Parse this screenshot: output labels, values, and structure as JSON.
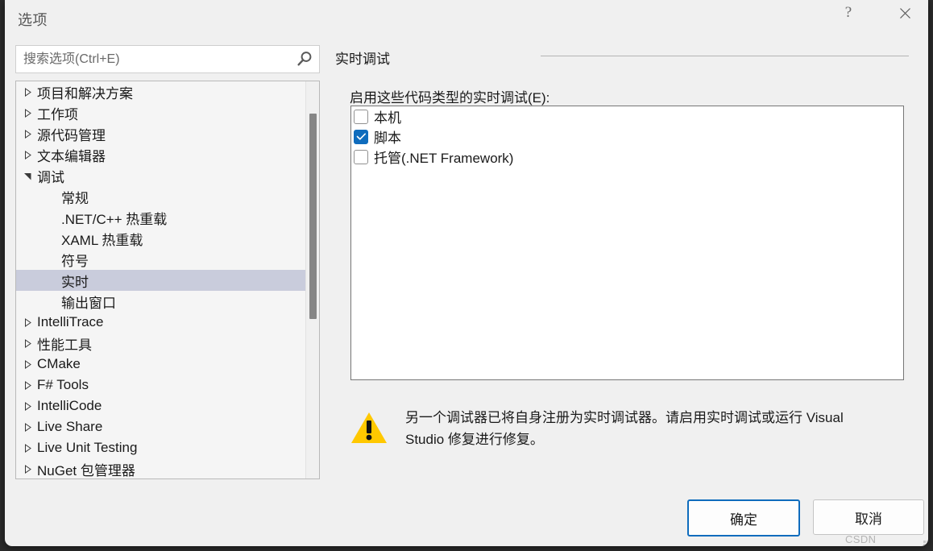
{
  "window": {
    "title": "选项",
    "help_icon": "?",
    "close_icon": "✕"
  },
  "search": {
    "placeholder": "搜索选项(Ctrl+E)",
    "value": "",
    "icon": "search-icon"
  },
  "tree": {
    "items": [
      {
        "label": "项目和解决方案",
        "level": 0,
        "state": "collapsed",
        "selected": false
      },
      {
        "label": "工作项",
        "level": 0,
        "state": "collapsed",
        "selected": false
      },
      {
        "label": "源代码管理",
        "level": 0,
        "state": "collapsed",
        "selected": false
      },
      {
        "label": "文本编辑器",
        "level": 0,
        "state": "collapsed",
        "selected": false
      },
      {
        "label": "调试",
        "level": 0,
        "state": "expanded",
        "selected": false
      },
      {
        "label": "常规",
        "level": 1,
        "state": "leaf",
        "selected": false
      },
      {
        "label": ".NET/C++ 热重载",
        "level": 1,
        "state": "leaf",
        "selected": false
      },
      {
        "label": "XAML 热重载",
        "level": 1,
        "state": "leaf",
        "selected": false
      },
      {
        "label": "符号",
        "level": 1,
        "state": "leaf",
        "selected": false
      },
      {
        "label": "实时",
        "level": 1,
        "state": "leaf",
        "selected": true
      },
      {
        "label": "输出窗口",
        "level": 1,
        "state": "leaf",
        "selected": false
      },
      {
        "label": "IntelliTrace",
        "level": 0,
        "state": "collapsed",
        "selected": false
      },
      {
        "label": "性能工具",
        "level": 0,
        "state": "collapsed",
        "selected": false
      },
      {
        "label": "CMake",
        "level": 0,
        "state": "collapsed",
        "selected": false
      },
      {
        "label": "F# Tools",
        "level": 0,
        "state": "collapsed",
        "selected": false
      },
      {
        "label": "IntelliCode",
        "level": 0,
        "state": "collapsed",
        "selected": false
      },
      {
        "label": "Live Share",
        "level": 0,
        "state": "collapsed",
        "selected": false
      },
      {
        "label": "Live Unit Testing",
        "level": 0,
        "state": "collapsed",
        "selected": false
      },
      {
        "label": "NuGet 包管理器",
        "level": 0,
        "state": "collapsed",
        "selected": false
      }
    ]
  },
  "pane": {
    "title": "实时调试",
    "codetypes_label": "启用这些代码类型的实时调试(E):",
    "codetypes": [
      {
        "label": "本机",
        "checked": false
      },
      {
        "label": "脚本",
        "checked": true
      },
      {
        "label": "托管(.NET Framework)",
        "checked": false
      }
    ]
  },
  "warning": {
    "icon": "warning-triangle-icon",
    "text": "另一个调试器已将自身注册为实时调试器。请启用实时调试或运行 Visual Studio 修复进行修复。"
  },
  "footer": {
    "ok_label": "确定",
    "cancel_label": "取消"
  },
  "watermark": {
    "text": "CSDN @mahuifa"
  },
  "colors": {
    "accent": "#0f6cbd",
    "selection": "#c9ccdc",
    "dialog_bg": "#f0f0f0",
    "warning_yellow": "#ffc800",
    "scrollbar_thumb": "#868686"
  }
}
